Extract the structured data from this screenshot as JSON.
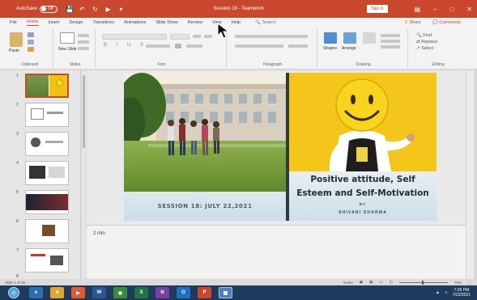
{
  "window": {
    "autosave_label": "AutoSave",
    "autosave_state": "Off",
    "title": "Session 18 - Teamwork",
    "signin_label": "Sign in",
    "accent_color": "#c8472d"
  },
  "tabs": [
    "File",
    "Home",
    "Insert",
    "Design",
    "Transitions",
    "Animations",
    "Slide Show",
    "Review",
    "View",
    "Help"
  ],
  "active_tab": "Home",
  "search_label": "Search",
  "share_label": "Share",
  "comments_label": "Comments",
  "ribbon": {
    "groups": [
      "Clipboard",
      "Slides",
      "Font",
      "Paragraph",
      "Drawing",
      "Editing"
    ],
    "paste_label": "Paste",
    "new_slide_label": "New Slide",
    "shapes_label": "Shapes",
    "arrange_label": "Arrange",
    "find_label": "Find",
    "replace_label": "Replace",
    "select_label": "Select"
  },
  "slides": [
    {
      "number": "1"
    },
    {
      "number": "2"
    },
    {
      "number": "3"
    },
    {
      "number": "4"
    },
    {
      "number": "5"
    },
    {
      "number": "6"
    },
    {
      "number": "7"
    },
    {
      "number": "8"
    }
  ],
  "selected_slide": 1,
  "current_slide": {
    "session_line": "SESSION 18: JULY 22,2021",
    "topic_line1": "Positive attitude, Self",
    "topic_line2": "Esteem and Self-Motivation",
    "by": "BY",
    "author": "SHIVANI SHARMA"
  },
  "notes": "2 min",
  "status": {
    "slide_counter": "Slide 1 of 35",
    "notes_label": "Notes",
    "zoom": "70%"
  },
  "taskbar": {
    "time": "7:26 PM",
    "date": "7/22/2021"
  }
}
